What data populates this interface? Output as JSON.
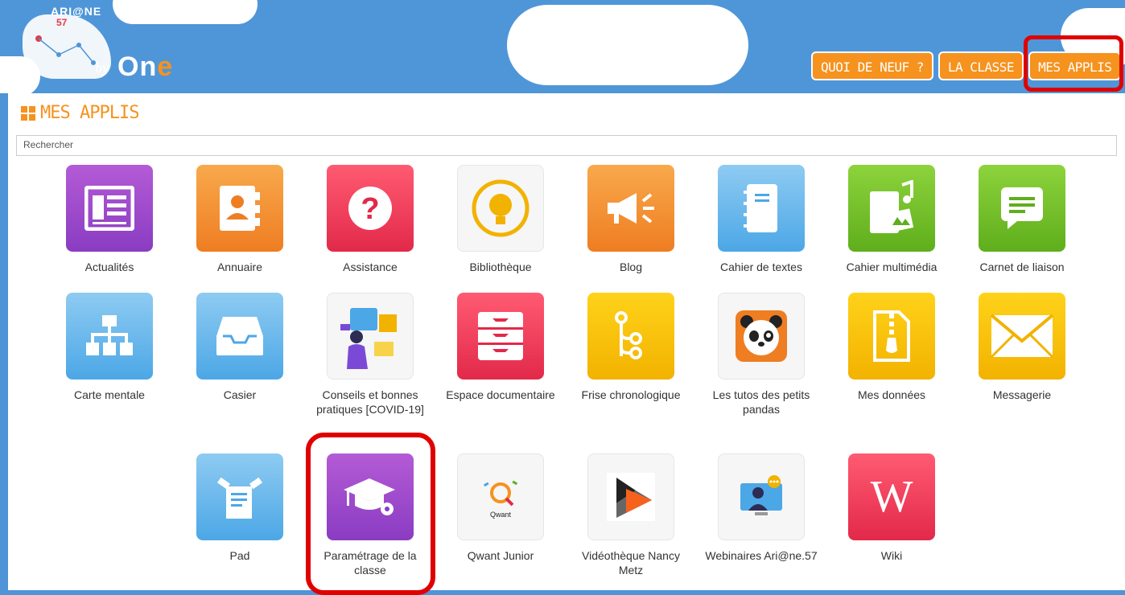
{
  "header": {
    "logo_title": "ARI@NE",
    "logo_subtitle": "57",
    "logo_by": "by",
    "logo_brand_o": "O",
    "logo_brand_n": "n",
    "logo_brand_e": "e",
    "nav": [
      {
        "label": "QUOI DE NEUF ?"
      },
      {
        "label": "LA CLASSE"
      },
      {
        "label": "MES APPLIS"
      }
    ]
  },
  "panel": {
    "title": "MES APPLIS",
    "search_placeholder": "Rechercher"
  },
  "apps": [
    {
      "label": "Actualités",
      "icon": "newspaper-icon"
    },
    {
      "label": "Annuaire",
      "icon": "contact-book-icon"
    },
    {
      "label": "Assistance",
      "icon": "question-icon"
    },
    {
      "label": "Bibliothèque",
      "icon": "lightbulb-icon"
    },
    {
      "label": "Blog",
      "icon": "megaphone-icon"
    },
    {
      "label": "Cahier de textes",
      "icon": "notebook-icon"
    },
    {
      "label": "Cahier multimédia",
      "icon": "music-notebook-icon"
    },
    {
      "label": "Carnet de liaison",
      "icon": "message-icon"
    },
    {
      "label": "Carte mentale",
      "icon": "sitemap-icon"
    },
    {
      "label": "Casier",
      "icon": "inbox-tray-icon"
    },
    {
      "label": "Conseils et bonnes pratiques [COVID-19]",
      "icon": "illustration-icon"
    },
    {
      "label": "Espace documentaire",
      "icon": "drawers-icon"
    },
    {
      "label": "Frise chronologique",
      "icon": "timeline-icon"
    },
    {
      "label": "Les tutos des petits pandas",
      "icon": "panda-icon"
    },
    {
      "label": "Mes données",
      "icon": "zip-file-icon"
    },
    {
      "label": "Messagerie",
      "icon": "envelope-icon"
    },
    {
      "label": "Pad",
      "icon": "pad-icon"
    },
    {
      "label": "Paramétrage de la classe",
      "icon": "graduation-cap-icon"
    },
    {
      "label": "Qwant Junior",
      "icon": "qwant-icon",
      "logo_text": "Qwant"
    },
    {
      "label": "Vidéothèque Nancy Metz",
      "icon": "play-icon"
    },
    {
      "label": "Webinaires Ari@ne.57",
      "icon": "webinar-icon"
    },
    {
      "label": "Wiki",
      "icon": "wiki-icon",
      "logo_text": "W"
    }
  ]
}
